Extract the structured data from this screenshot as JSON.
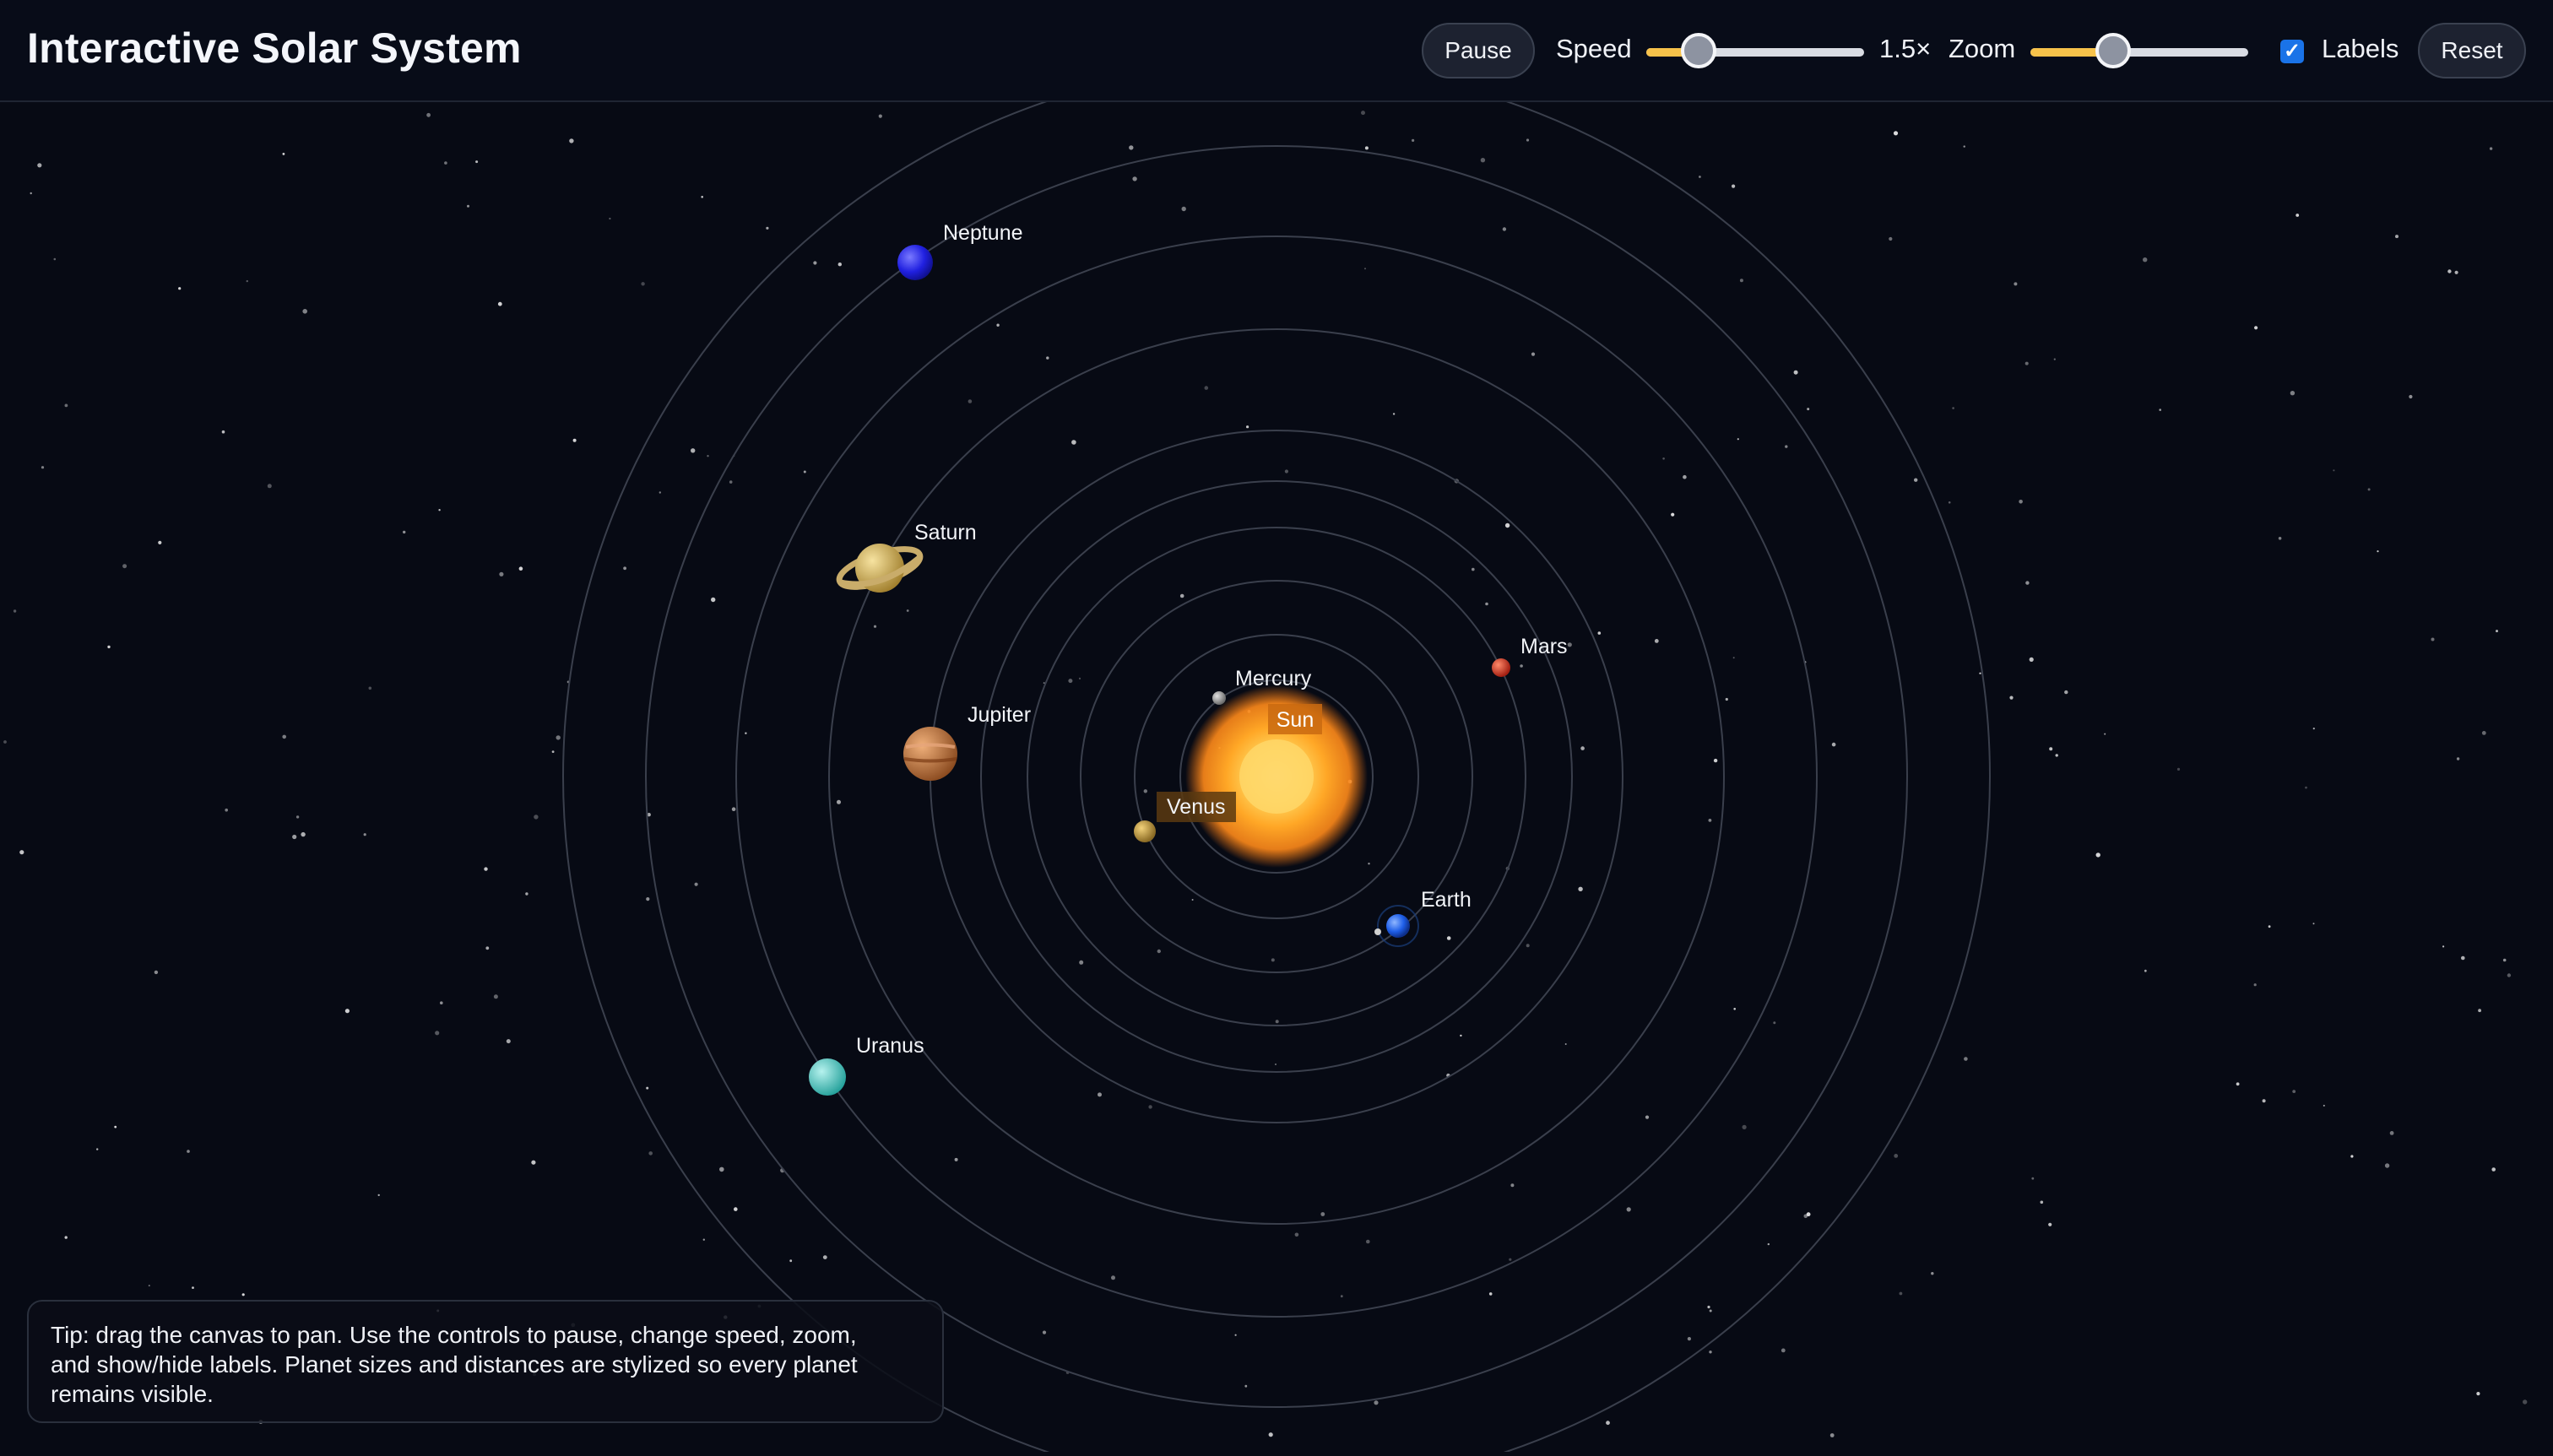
{
  "header": {
    "title": "Interactive Solar System",
    "pause_label": "Pause",
    "speed_label": "Speed",
    "speed_value_text": "1.5×",
    "speed_level": 0.24,
    "zoom_label": "Zoom",
    "zoom_level": 0.38,
    "labels_label": "Labels",
    "labels_checked": true,
    "reset_label": "Reset"
  },
  "bodies": {
    "sun": "Sun",
    "mercury": "Mercury",
    "venus": "Venus",
    "earth": "Earth",
    "mars": "Mars",
    "jupiter": "Jupiter",
    "saturn": "Saturn",
    "uranus": "Uranus",
    "neptune": "Neptune"
  },
  "tip": {
    "line1": "Tip: drag the canvas to pan. Use the controls to pause, change speed, zoom,",
    "line2": "and show/hide labels. Planet sizes and distances are stylized so every planet",
    "line3": "remains visible."
  },
  "colors": {
    "background": "#070a14",
    "accent": "#f7c24a",
    "checkbox": "#1a73e8",
    "sun": "#ffa726",
    "mercury": "#a8a8a8",
    "venus": "#d4a94a",
    "earth": "#2e6bff",
    "mars": "#d9422b",
    "jupiter": "#c97b3f",
    "saturn": "#d9b55a",
    "uranus": "#4ecdc4",
    "neptune": "#2424e0"
  }
}
